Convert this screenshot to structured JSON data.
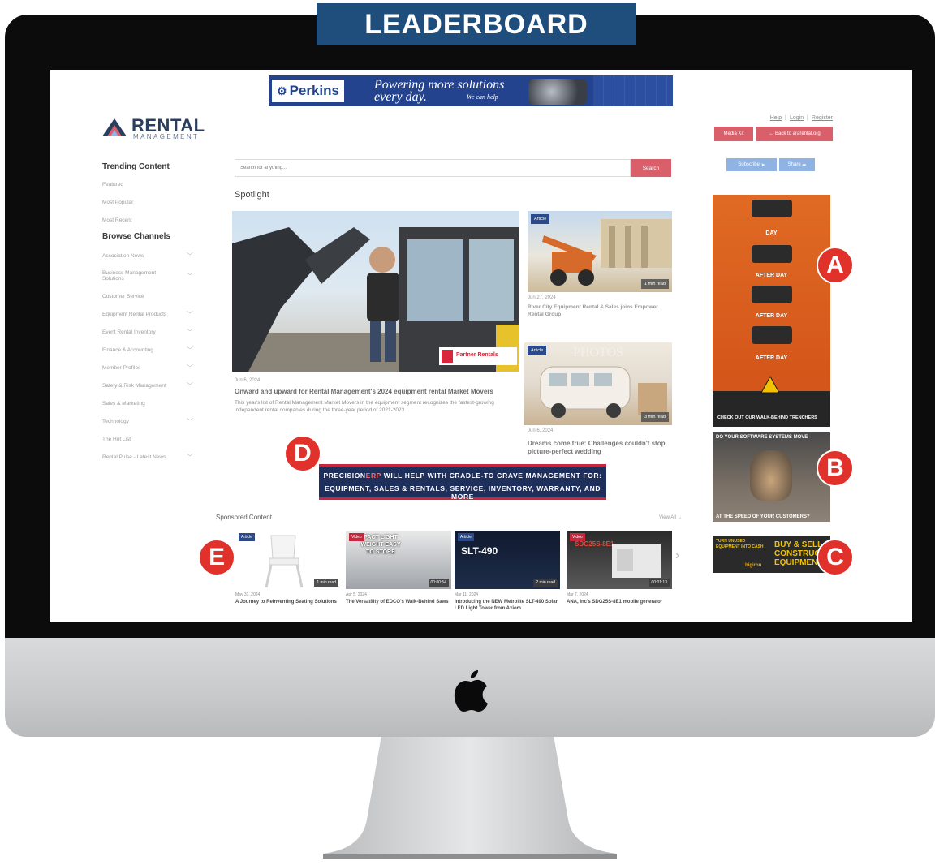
{
  "label": {
    "title": "LEADERBOARD"
  },
  "leaderboard_ad": {
    "brand": "Perkins",
    "line1": "Powering more solutions",
    "line2": "every day.",
    "cta": "We can help"
  },
  "header": {
    "logo_word": "RENTAL",
    "logo_sub": "MANAGEMENT",
    "links": [
      "Help",
      "Login",
      "Register"
    ],
    "media_kit": "Media Kit",
    "back_link": "← Back to ararental.org",
    "subscribe": "Subscribe",
    "share": "Share"
  },
  "sidebar": {
    "trending_title": "Trending Content",
    "trending": [
      "Featured",
      "Most Popular",
      "Most Recent"
    ],
    "browse_title": "Browse Channels",
    "channels": [
      "Association News",
      "Business Management Solutions",
      "Customer Service",
      "Equipment Rental Products",
      "Event Rental Inventory",
      "Finance & Accounting",
      "Member Profiles",
      "Safety & Risk Management",
      "Sales & Marketing",
      "Technology",
      "The Hot List",
      "Rental Pulse - Latest News"
    ]
  },
  "search": {
    "placeholder": "Search for anything...",
    "button": "Search"
  },
  "spotlight": {
    "title": "Spotlight",
    "main": {
      "date": "Jun 6, 2024",
      "headline": "Onward and upward for Rental Management's 2024 equipment rental Market Movers",
      "excerpt": "This year's list of Rental Management Market Movers in the equipment segment recognizes the fastest-growing independent rental companies during the three-year period of 2021-2023.",
      "photo_sign": "Partner Rentals"
    },
    "side": [
      {
        "badge": "Article",
        "read": "1 min read",
        "date": "Jun 27, 2024",
        "headline": "River City Equipment Rental & Sales joins Empower Rental Group"
      },
      {
        "badge": "Article",
        "read": "3 min read",
        "date": "Jun 6, 2024",
        "headline": "Dreams come true: Challenges couldn't stop picture-perfect wedding",
        "overlay": "PHOTOS"
      }
    ]
  },
  "ads": {
    "a": {
      "lines": [
        "DAY",
        "AFTER DAY",
        "AFTER DAY",
        "AFTER DAY"
      ],
      "footer": "CHECK OUT OUR WALK-BEHIND TRENCHERS"
    },
    "b": {
      "top": "DO YOUR SOFTWARE SYSTEMS MOVE",
      "bottom": "AT THE SPEED OF YOUR CUSTOMERS?"
    },
    "c": {
      "left": "TURN UNUSED EQUIPMENT INTO CASH",
      "right": "BUY & SELL CONSTRUCTION EQUIPMENT",
      "brand": "bigiron"
    },
    "d": {
      "brand_a": "PRECISION",
      "brand_b": "ERP",
      "line1": " WILL HELP WITH CRADLE-TO GRAVE MANAGEMENT FOR:",
      "line2": "EQUIPMENT, SALES & RENTALS, SERVICE, INVENTORY, WARRANTY, AND MORE"
    }
  },
  "sponsored": {
    "title": "Sponsored Content",
    "view_all": "View All →",
    "cards": [
      {
        "badge": "Article",
        "duration": "1 min read",
        "date": "May 31, 2024",
        "headline": "A Journey to Reinventing Seating Solutions"
      },
      {
        "badge": "Video",
        "duration": "00:00:54",
        "overlay": "PACT LIGHT WEIGHT EASY TO STORE",
        "date": "Apr 5, 2024",
        "headline": "The Versatility of EDCO's Walk-Behind Saws"
      },
      {
        "badge": "Article",
        "duration": "2 min read",
        "overlay": "SLT-490",
        "date": "Mar 11, 2024",
        "headline": "Introducing the NEW Metrolite SLT-490 Solar LED Light Tower from Axiom"
      },
      {
        "badge": "Video",
        "duration": "00:01:13",
        "overlay": "SDG25S-8E1",
        "date": "Mar 7, 2024",
        "headline": "ANA, Inc's SDG25S-8E1 mobile generator"
      }
    ]
  },
  "callouts": [
    "A",
    "B",
    "C",
    "D",
    "E"
  ],
  "colors": {
    "label_blue": "#1f4e7c",
    "accent_red": "#d9606a",
    "callout_red": "#e0312a",
    "button_blue": "#8fb3e2"
  }
}
